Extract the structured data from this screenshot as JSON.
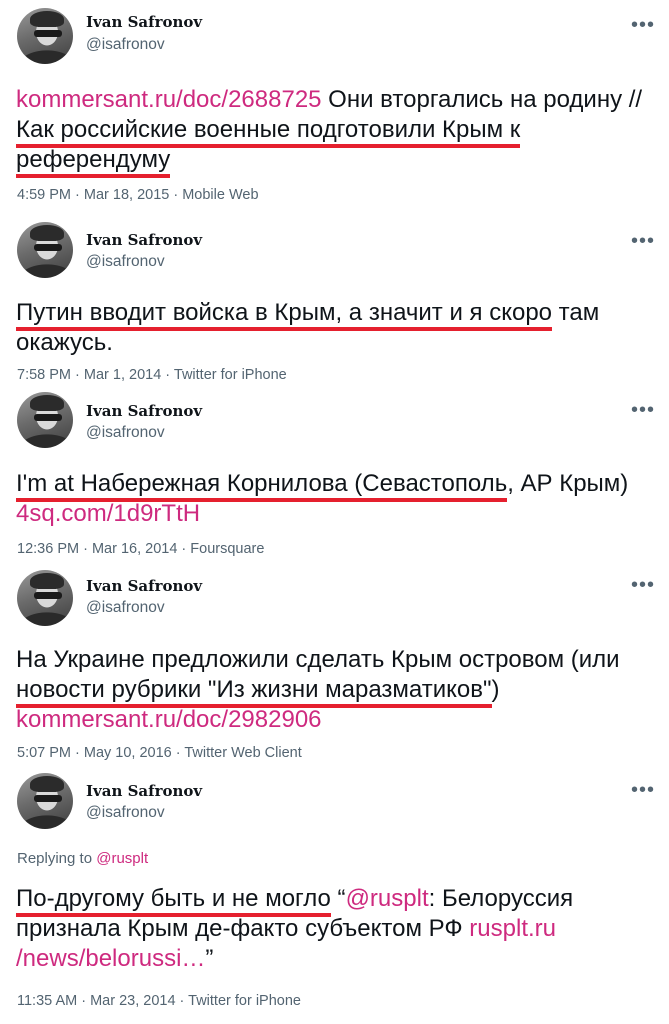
{
  "tweets": [
    {
      "name": "Ivan Safronov",
      "handle": "@isafronov",
      "link1": "kommersant.ru/doc/2688725",
      "text_a": " Они вторгались на родину // ",
      "text_ul": "Как российские военные подготовили Крым к референдуму",
      "meta": "4:59 PM · Mar 18, 2015 · Mobile Web"
    },
    {
      "name": "Ivan Safronov",
      "handle": "@isafronov",
      "text_ul": "Путин вводит войска в Крым, а значит и я скоро",
      "text_b": " там окажусь.",
      "meta": "7:58 PM · Mar 1, 2014 · Twitter for iPhone"
    },
    {
      "name": "Ivan Safronov",
      "handle": "@isafronov",
      "text_ul": "I'm at Набережная Корнилова (Севастополь",
      "text_b": ", АР Крым) ",
      "link1": "4sq.com/1d9rTtH",
      "meta": "12:36 PM · Mar 16, 2014 · Foursquare"
    },
    {
      "name": "Ivan Safronov",
      "handle": "@isafronov",
      "text_a": "На Украине предложили сделать Крым островом (или ",
      "text_ul": "новости рубрики \"Из жизни маразматиков\"",
      "text_b": ")",
      "link1": "kommersant.ru/doc/2982906",
      "meta": "5:07 PM · May 10, 2016 · Twitter Web Client"
    },
    {
      "name": "Ivan Safronov",
      "handle": "@isafronov",
      "reply_prefix": "Replying to ",
      "reply_handle": "@rusplt",
      "text_ul": "По-другому быть и не могло",
      "text_a": " “",
      "mention": "@rusplt",
      "text_b": ": Белоруссия признала Крым де-факто субъектом РФ ",
      "link1": "rusplt.ru /news/belorussi…",
      "text_c": "”",
      "meta": "11:35 AM · Mar 23, 2014 · Twitter for iPhone"
    }
  ],
  "icons": {
    "more": "more-horizontal-icon"
  },
  "colors": {
    "link": "#ce2a7f",
    "underline": "#e5202e",
    "secondary": "#536471"
  }
}
